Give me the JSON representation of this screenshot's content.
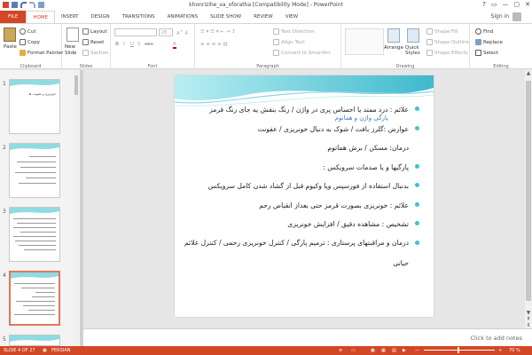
{
  "window": {
    "title": "khonrizihe_va_oforatha [Compatibility Mode] - PowerPoint",
    "controls": [
      "?",
      "▭",
      "—",
      "▢",
      "✕"
    ]
  },
  "tabs": [
    "FILE",
    "HOME",
    "INSERT",
    "DESIGN",
    "TRANSITIONS",
    "ANIMATIONS",
    "SLIDE SHOW",
    "REVIEW",
    "VIEW"
  ],
  "account": {
    "sign_in": "Sign in"
  },
  "ribbon": {
    "clipboard": {
      "paste": "Paste",
      "cut": "Cut",
      "copy": "Copy",
      "format_painter": "Format Painter",
      "label": "Clipboard"
    },
    "slides": {
      "new_slide": "New\nSlide",
      "layout": "Layout",
      "reset": "Reset",
      "section": "Section",
      "label": "Slides"
    },
    "font": {
      "size": "28",
      "bold": "B",
      "italic": "I",
      "underline": "U",
      "shadow": "S",
      "strike": "abc",
      "label": "Font"
    },
    "paragraph": {
      "text_direction": "Text Direction",
      "align_text": "Align Text",
      "smartart": "Convert to SmartArt",
      "label": "Paragraph"
    },
    "drawing": {
      "arrange": "Arrange",
      "quick_styles": "Quick\nStyles",
      "shape_fill": "Shape Fill",
      "shape_outline": "Shape Outline",
      "shape_effects": "Shape Effects",
      "label": "Drawing"
    },
    "editing": {
      "find": "Find",
      "replace": "Replace",
      "select": "Select",
      "label": "Editing"
    }
  },
  "slides_pane": {
    "thumbs": [
      {
        "num": "1",
        "title": "خونریزی و عفونت ها"
      },
      {
        "num": "2",
        "title": ""
      },
      {
        "num": "3",
        "title": ""
      },
      {
        "num": "4",
        "title": ""
      },
      {
        "num": "5",
        "title": ""
      }
    ]
  },
  "slide": {
    "overlay_title": "پارگی واژن و همانوم",
    "bullets": [
      {
        "text": "علائم : درد ممتد یا احساس پری در واژن / رنگ بنفش یه جای رنگ قرمز",
        "dot": true
      },
      {
        "text": "عوارض :گلرز بافت / شوک به دنبال خونریزی / عفونت",
        "dot": true
      },
      {
        "text": "درمان: مسکن / برش هماتوم",
        "dot": false
      },
      {
        "text": "پارگیها و یا صدمات سرویکس :",
        "dot": true
      },
      {
        "text": "بدنبال استفاده از فورسپس ویا وکیوم قبل از گشاد شدن کامل سرویکس",
        "dot": true
      },
      {
        "text": "علائم : خونریزی بصورت قرمز حتی بعداز انقباض رحم",
        "dot": true
      },
      {
        "text": "تشخیص : مشاهده دقیق / افزایش خونریزی",
        "dot": true
      },
      {
        "text": "درمان و مراقبتهای پرستاری : ترمیم پارگی / کنترل خونریزی رحمی / کنترل علائم",
        "dot": true
      },
      {
        "text": "حیاتی",
        "dot": false
      }
    ]
  },
  "notes": {
    "placeholder": "Click to add notes"
  },
  "status": {
    "slide": "SLIDE 4 OF 27",
    "language": "PERSIAN",
    "zoom": "70 %"
  },
  "colors": {
    "accent": "#d24726",
    "teal": "#5ec8d8",
    "bullet": "#3ec3cf"
  },
  "icons": [
    "save-icon",
    "undo-icon",
    "redo-icon",
    "slideshow-icon",
    "paste-icon",
    "cut-icon",
    "copy-icon",
    "format-painter-icon",
    "new-slide-icon",
    "find-icon",
    "replace-icon",
    "select-icon",
    "arrange-icon",
    "quick-styles-icon"
  ]
}
